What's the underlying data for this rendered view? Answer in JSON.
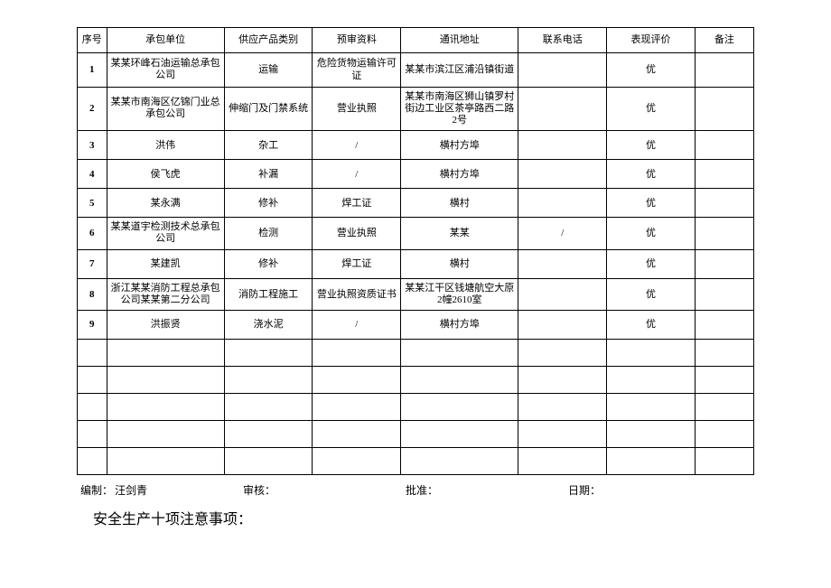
{
  "table": {
    "headers": [
      "序号",
      "承包单位",
      "供应产品类别",
      "预审资料",
      "通讯地址",
      "联系电话",
      "表现评价",
      "备注"
    ],
    "rows": [
      {
        "seq": "1",
        "unit": "某某环峰石油运输总承包公司",
        "category": "运输",
        "material": "危险货物运输许可证",
        "address": "某某市滨江区浦沿镇街道",
        "phone": "",
        "eval": "优",
        "remark": ""
      },
      {
        "seq": "2",
        "unit": "某某市南海区亿锦门业总承包公司",
        "category": "伸缩门及门禁系统",
        "material": "营业执照",
        "address": "某某市南海区狮山镇罗村街边工业区茶亭路西二路2号",
        "phone": "",
        "eval": "优",
        "remark": ""
      },
      {
        "seq": "3",
        "unit": "洪伟",
        "category": "杂工",
        "material": "/",
        "address": "横村方埠",
        "phone": "",
        "eval": "优",
        "remark": ""
      },
      {
        "seq": "4",
        "unit": "侯飞虎",
        "category": "补漏",
        "material": "/",
        "address": "横村方埠",
        "phone": "",
        "eval": "优",
        "remark": ""
      },
      {
        "seq": "5",
        "unit": "某永满",
        "category": "修补",
        "material": "焊工证",
        "address": "横村",
        "phone": "",
        "eval": "优",
        "remark": ""
      },
      {
        "seq": "6",
        "unit": "某某道宇检测技术总承包公司",
        "category": "检测",
        "material": "营业执照",
        "address": "某某",
        "phone": "/",
        "eval": "优",
        "remark": ""
      },
      {
        "seq": "7",
        "unit": "某建凯",
        "category": "修补",
        "material": "焊工证",
        "address": "横村",
        "phone": "",
        "eval": "优",
        "remark": ""
      },
      {
        "seq": "8",
        "unit": "浙江某某消防工程总承包公司某某第二分公司",
        "category": "消防工程施工",
        "material": "营业执照资质证书",
        "address": "某某江干区钱塘航空大原2幢2610室",
        "phone": "",
        "eval": "优",
        "remark": ""
      },
      {
        "seq": "9",
        "unit": "洪振贤",
        "category": "浇水泥",
        "material": "/",
        "address": "横村方埠",
        "phone": "",
        "eval": "优",
        "remark": ""
      }
    ],
    "empty_rows": 5
  },
  "footer": {
    "compiler_label": "编制：",
    "compiler_value": "汪剑青",
    "reviewer_label": "审核：",
    "reviewer_value": "",
    "approver_label": "批准：",
    "approver_value": "",
    "date_label": "日期：",
    "date_value": ""
  },
  "section_title": "安全生产十项注意事项："
}
